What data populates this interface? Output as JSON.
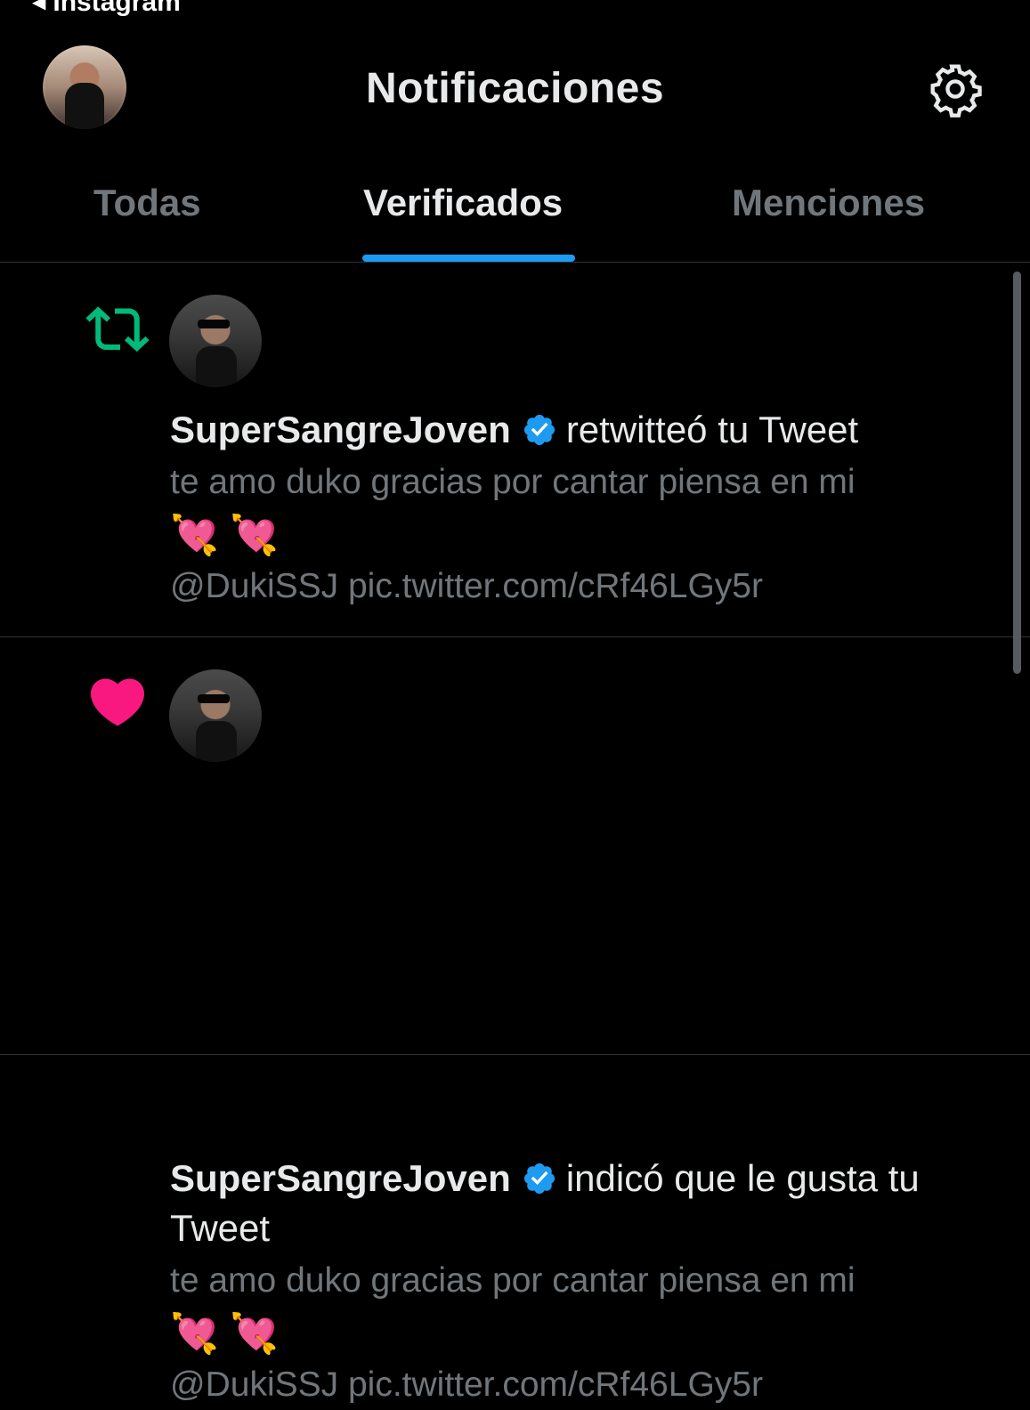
{
  "statusbar": {
    "back_label": "◀",
    "back_app": "Instagram"
  },
  "header": {
    "title": "Notificaciones"
  },
  "tabs": [
    {
      "label": "Todas"
    },
    {
      "label": "Verificados"
    },
    {
      "label": "Menciones"
    }
  ],
  "active_tab": "Verificados",
  "accent_color": "#1d9bf0",
  "notifications": [
    {
      "type_icon": "retweet-icon",
      "type_color": "#00ba7c",
      "user": "SuperSangreJoven",
      "verified": true,
      "action": "retwitteó tu Tweet",
      "tweet_text": "te amo duko gracias por cantar piensa en mi",
      "emojis": "💘 💘",
      "links": "@DukiSSJ pic.twitter.com/cRf46LGy5r"
    },
    {
      "type_icon": "heart-icon",
      "type_color": "#f91880",
      "user": "SuperSangreJoven",
      "verified": true,
      "action": "indicó que le gusta tu Tweet",
      "tweet_text": "te amo duko gracias por cantar piensa en mi",
      "emojis": "💘 💘",
      "links": "@DukiSSJ pic.twitter.com/cRf46LGy5r"
    }
  ]
}
